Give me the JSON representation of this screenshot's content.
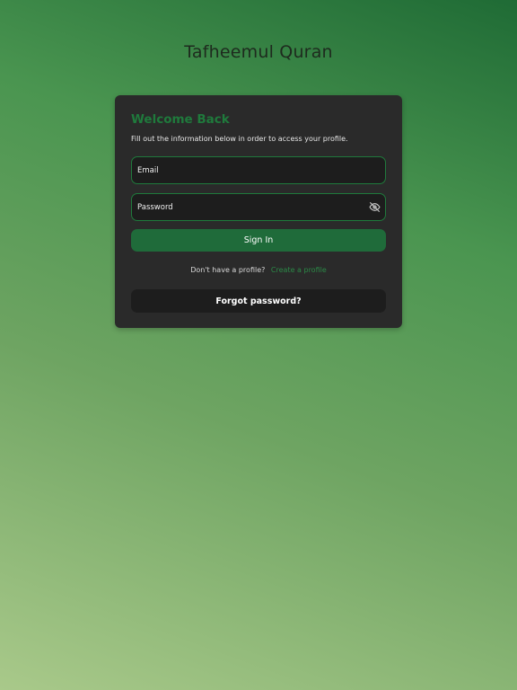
{
  "app": {
    "title": "Tafheemul Quran"
  },
  "login": {
    "title": "Welcome Back",
    "subtitle": "Fill out the information below in order to access your profile.",
    "email_placeholder": "Email",
    "password_placeholder": "Password",
    "toggle_icon": "eye-off-icon",
    "sign_in_label": "Sign In",
    "register_prompt": "Don't have a profile?",
    "register_link": "Create a profile",
    "forgot_label": "Forgot password?"
  },
  "colors": {
    "accent": "#1f7a3c",
    "button": "#1f6b3a",
    "card": "#2a2a2a",
    "field": "#1d1d1d",
    "link": "#2b8a47"
  }
}
